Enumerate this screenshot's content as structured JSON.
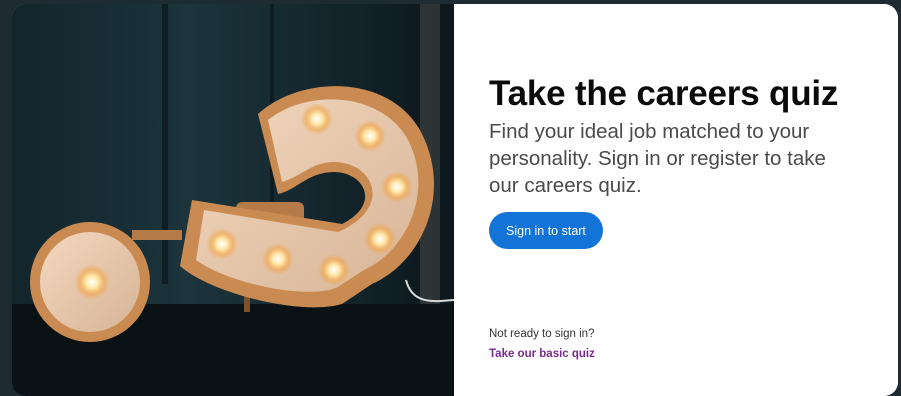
{
  "hero": {
    "image_alt": "Illuminated question mark marquee sign"
  },
  "quiz": {
    "title": "Take the careers quiz",
    "description": "Find your ideal job matched to your personality. Sign in or register to take our careers quiz.",
    "sign_in_label": "Sign in to start",
    "not_ready_text": "Not ready to sign in?",
    "basic_quiz_label": "Take our basic quiz"
  },
  "colors": {
    "primary_button": "#1473d7",
    "link": "#7b2a8f",
    "title_text": "#0b0b0b",
    "body_text": "#4a4a4a",
    "page_background": "#1f2b33"
  }
}
